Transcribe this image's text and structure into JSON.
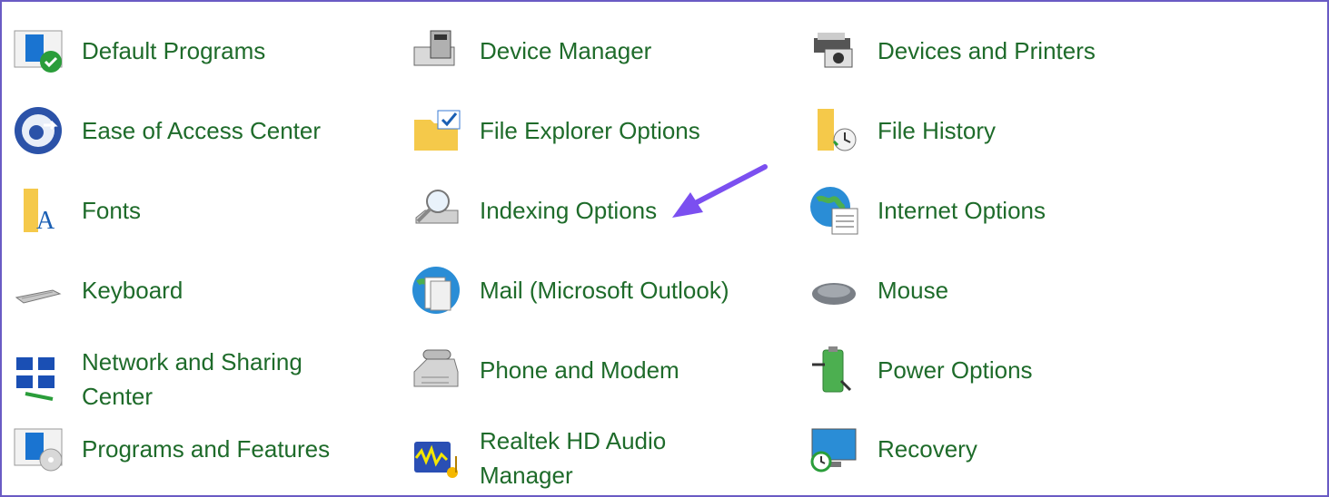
{
  "panel": {
    "items": [
      {
        "label": "Default Programs",
        "icon": "default-programs-icon"
      },
      {
        "label": "Device Manager",
        "icon": "device-manager-icon"
      },
      {
        "label": "Devices and Printers",
        "icon": "devices-printers-icon"
      },
      {
        "label": "Ease of Access Center",
        "icon": "ease-of-access-icon"
      },
      {
        "label": "File Explorer Options",
        "icon": "file-explorer-options-icon"
      },
      {
        "label": "File History",
        "icon": "file-history-icon"
      },
      {
        "label": "Fonts",
        "icon": "fonts-icon"
      },
      {
        "label": "Indexing Options",
        "icon": "indexing-options-icon"
      },
      {
        "label": "Internet Options",
        "icon": "internet-options-icon"
      },
      {
        "label": "Keyboard",
        "icon": "keyboard-icon"
      },
      {
        "label": "Mail (Microsoft Outlook)",
        "icon": "mail-icon"
      },
      {
        "label": "Mouse",
        "icon": "mouse-icon"
      },
      {
        "label": "Network and Sharing Center",
        "icon": "network-sharing-icon"
      },
      {
        "label": "Phone and Modem",
        "icon": "phone-modem-icon"
      },
      {
        "label": "Power Options",
        "icon": "power-options-icon"
      },
      {
        "label": "Programs and Features",
        "icon": "programs-features-icon"
      },
      {
        "label": "Realtek HD Audio Manager",
        "icon": "realtek-audio-icon"
      },
      {
        "label": "Recovery",
        "icon": "recovery-icon"
      }
    ]
  },
  "annotation": {
    "type": "arrow",
    "color": "#7b4ff0",
    "points_to": "Indexing Options"
  }
}
